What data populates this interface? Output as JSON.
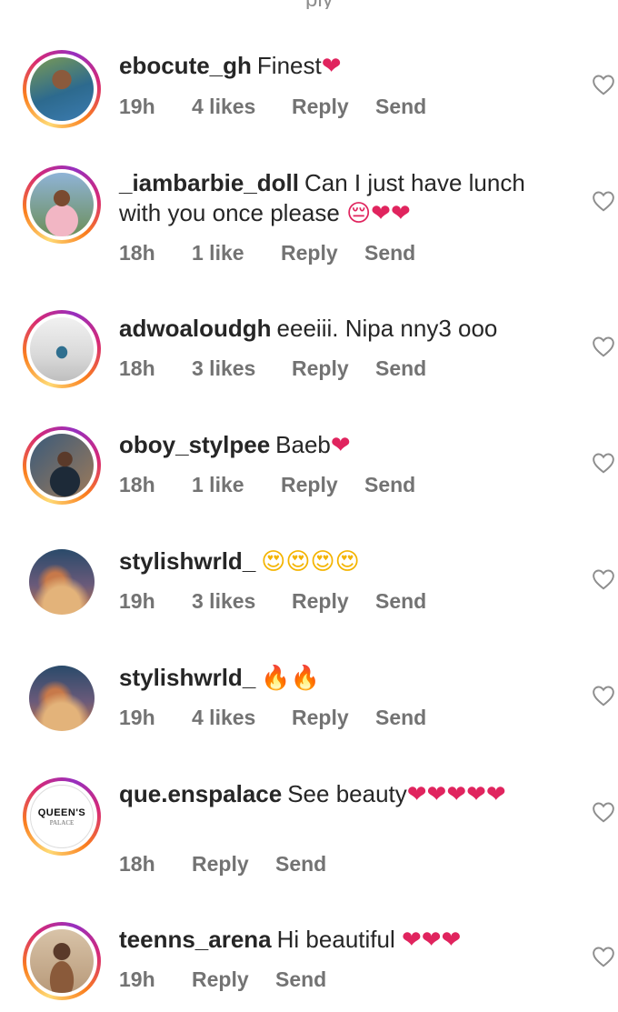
{
  "top_partial_text": "ply",
  "comments": [
    {
      "username": "ebocute_gh",
      "text": "Finest",
      "emojis": "❤",
      "time": "19h",
      "likes": "4 likes",
      "reply": "Reply",
      "send": "Send",
      "avatar_style": "story",
      "avatar_colors": [
        "#7a9a55",
        "#2d6a8e",
        "#c9a27a"
      ]
    },
    {
      "username": "_iambarbie_doll",
      "text": "Can I just have lunch with you once please",
      "emojis": "😔❤❤",
      "time": "18h",
      "likes": "1 like",
      "reply": "Reply",
      "send": "Send",
      "avatar_style": "story",
      "avatar_colors": [
        "#8fb3d6",
        "#f2b6c4",
        "#6c8f5a"
      ]
    },
    {
      "username": "adwoaloudgh",
      "text": "eeeiii. Nipa nny3 ooo",
      "emojis": "",
      "time": "18h",
      "likes": "3 likes",
      "reply": "Reply",
      "send": "Send",
      "avatar_style": "story",
      "avatar_colors": [
        "#f1f1f1",
        "#2f6f8f",
        "#bfbfbf"
      ]
    },
    {
      "username": "oboy_stylpee",
      "text": "Baeb",
      "emojis": "❤",
      "time": "18h",
      "likes": "1 like",
      "reply": "Reply",
      "send": "Send",
      "avatar_style": "story",
      "avatar_colors": [
        "#3a5a7a",
        "#1d2a38",
        "#9c7a5a"
      ]
    },
    {
      "username": "stylishwrld_",
      "text": "",
      "emojis": "😍😍😍😍",
      "time": "19h",
      "likes": "3 likes",
      "reply": "Reply",
      "send": "Send",
      "avatar_style": "plain",
      "avatar_colors": [
        "#2a4a6a",
        "#c7794a",
        "#e3b37a"
      ]
    },
    {
      "username": "stylishwrld_",
      "text": "",
      "emojis": "🔥🔥",
      "time": "19h",
      "likes": "4 likes",
      "reply": "Reply",
      "send": "Send",
      "avatar_style": "plain",
      "avatar_colors": [
        "#2a4a6a",
        "#c7794a",
        "#e3b37a"
      ]
    },
    {
      "username": "que.enspalace",
      "text": "See beauty",
      "emojis": "❤❤❤❤❤",
      "time": "18h",
      "likes": "",
      "reply": "Reply",
      "send": "Send",
      "avatar_style": "story",
      "avatar_logo_title": "QUEEN'S",
      "avatar_logo_subtitle": "PALACE"
    },
    {
      "username": "teenns_arena",
      "text": "Hi beautiful",
      "emojis": "❤❤❤",
      "time": "19h",
      "likes": "",
      "reply": "Reply",
      "send": "Send",
      "avatar_style": "story",
      "avatar_colors": [
        "#b89a7a",
        "#5a3a2a",
        "#d8c3a8"
      ]
    }
  ],
  "colors": {
    "text": "#262626",
    "meta": "#737373",
    "heart_emoji": "#e0245e",
    "heart_outline": "#8e8e8e"
  }
}
